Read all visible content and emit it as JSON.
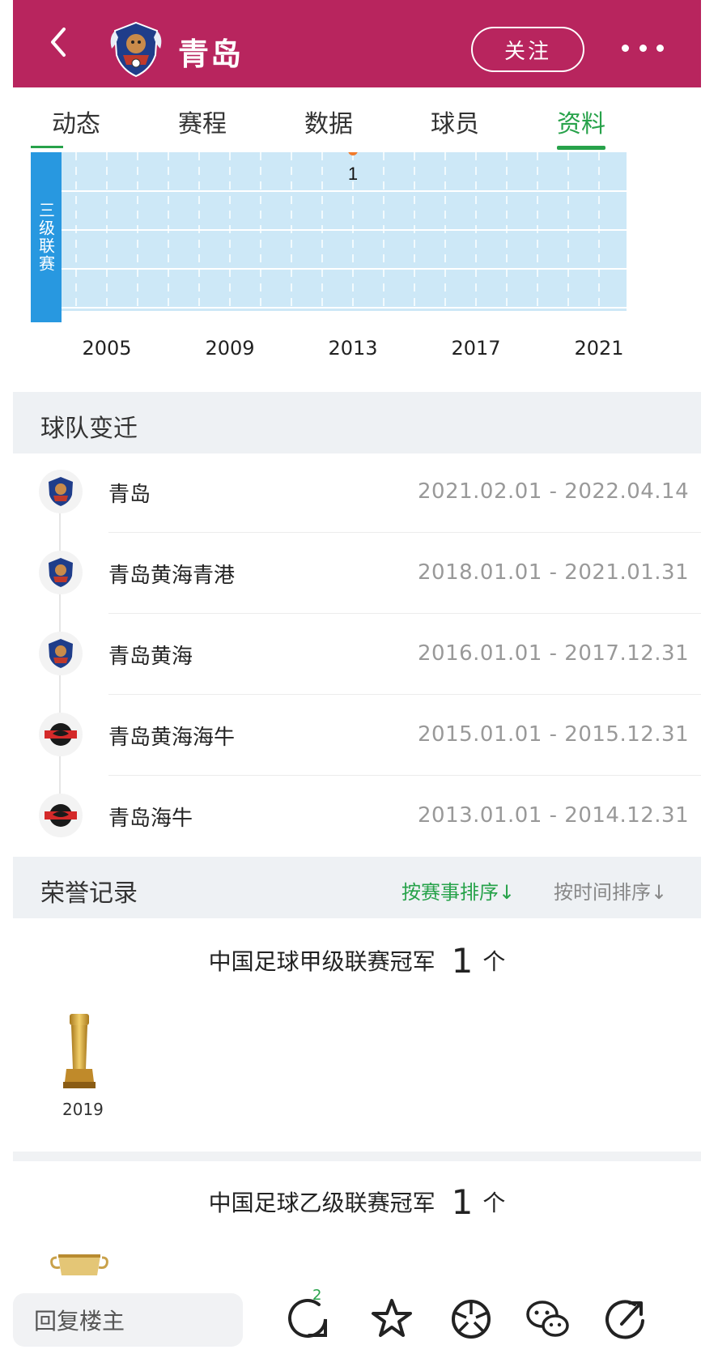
{
  "header": {
    "team_name": "青岛",
    "follow_label": "关注"
  },
  "tabs": [
    {
      "label": "动态"
    },
    {
      "label": "赛程"
    },
    {
      "label": "数据"
    },
    {
      "label": "球员"
    },
    {
      "label": "资料",
      "active": true
    }
  ],
  "chart_data": {
    "type": "scatter",
    "row_label": "三级联赛",
    "x_tick_labels": [
      "2005",
      "2009",
      "2013",
      "2017",
      "2021"
    ],
    "points": [
      {
        "x": 2013,
        "label": "1"
      }
    ],
    "xlim": [
      2002,
      2022
    ],
    "grid": true,
    "colors": {
      "band": "#2898e0",
      "plot_bg": "#cde8f7",
      "point": "#f07a2a"
    }
  },
  "history_section": {
    "title": "球队变迁",
    "items": [
      {
        "name": "青岛",
        "date_range": "2021.02.01 - 2022.04.14",
        "logo": "blue-crest"
      },
      {
        "name": "青岛黄海青港",
        "date_range": "2018.01.01 - 2021.01.31",
        "logo": "blue-crest"
      },
      {
        "name": "青岛黄海",
        "date_range": "2016.01.01 - 2017.12.31",
        "logo": "blue-crest"
      },
      {
        "name": "青岛黄海海牛",
        "date_range": "2015.01.01 - 2015.12.31",
        "logo": "red-bull"
      },
      {
        "name": "青岛海牛",
        "date_range": "2013.01.01 - 2014.12.31",
        "logo": "red-bull"
      }
    ]
  },
  "honors_section": {
    "title": "荣誉记录",
    "sort_by_competition": "按赛事排序↓",
    "sort_by_time": "按时间排序↓",
    "groups": [
      {
        "name": "中国足球甲级联赛冠军",
        "count": "1",
        "unit": "个",
        "years": [
          "2019"
        ]
      },
      {
        "name": "中国足球乙级联赛冠军",
        "count": "1",
        "unit": "个",
        "years": []
      }
    ]
  },
  "bottom_bar": {
    "reply_placeholder": "回复楼主",
    "comment_badge": "2"
  }
}
